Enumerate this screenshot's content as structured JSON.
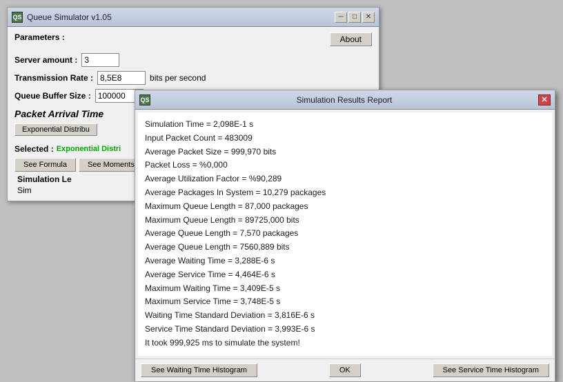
{
  "mainWindow": {
    "title": "Queue Simulator v1.05",
    "icon": "QS",
    "controls": {
      "minimize": "─",
      "maximize": "□",
      "close": "✕"
    }
  },
  "parameters": {
    "sectionLabel": "Parameters :",
    "aboutButton": "About",
    "serverAmountLabel": "Server amount :",
    "serverAmountValue": "3",
    "transmissionRateLabel": "Transmission Rate :",
    "transmissionRateValue": "8,5E8",
    "transmissionRateUnit": "bits per second",
    "queueBufferSizeLabel": "Queue Buffer Size :",
    "queueBufferSizeValue": "100000"
  },
  "packetArrival": {
    "label": "Packet Arrival Time",
    "distributionButton": "Exponential Distribu",
    "selectedLabel": "Selected :",
    "selectedValue": "Exponential Distri",
    "seeFormulaButton": "See Formula",
    "seeMomentsButton": "See Moments",
    "simulationLengthLabel": "Simulation Le",
    "simulationSubLabel": "Sim"
  },
  "resultsDialog": {
    "title": "Simulation Results Report",
    "icon": "QS",
    "lines": [
      "Simulation Time = 2,098E-1 s",
      "Input Packet Count = 483009",
      "Average Packet Size = 999,970 bits",
      "Packet Loss = %0,000",
      "Average Utilization Factor = %90,289",
      "Average Packages In System = 10,279 packages",
      "Maximum Queue Length = 87,000 packages",
      "Maximum Queue Length = 89725,000 bits",
      "Average Queue Length = 7,570 packages",
      "Average Queue Length = 7560,889 bits",
      "Average Waiting Time = 3,288E-6 s",
      "Average Service Time = 4,464E-6 s",
      "Maximum Waiting Time = 3,409E-5 s",
      "Maximum Service Time = 3,748E-5 s",
      "Waiting Time Standard Deviation = 3,816E-6 s",
      "Service Time Standard Deviation = 3,993E-6 s",
      "It took 999,925 ms to simulate the system!"
    ],
    "footer": {
      "waitingHistogramBtn": "See Waiting Time Histogram",
      "okBtn": "OK",
      "serviceHistogramBtn": "See Service Time Histogram"
    }
  }
}
